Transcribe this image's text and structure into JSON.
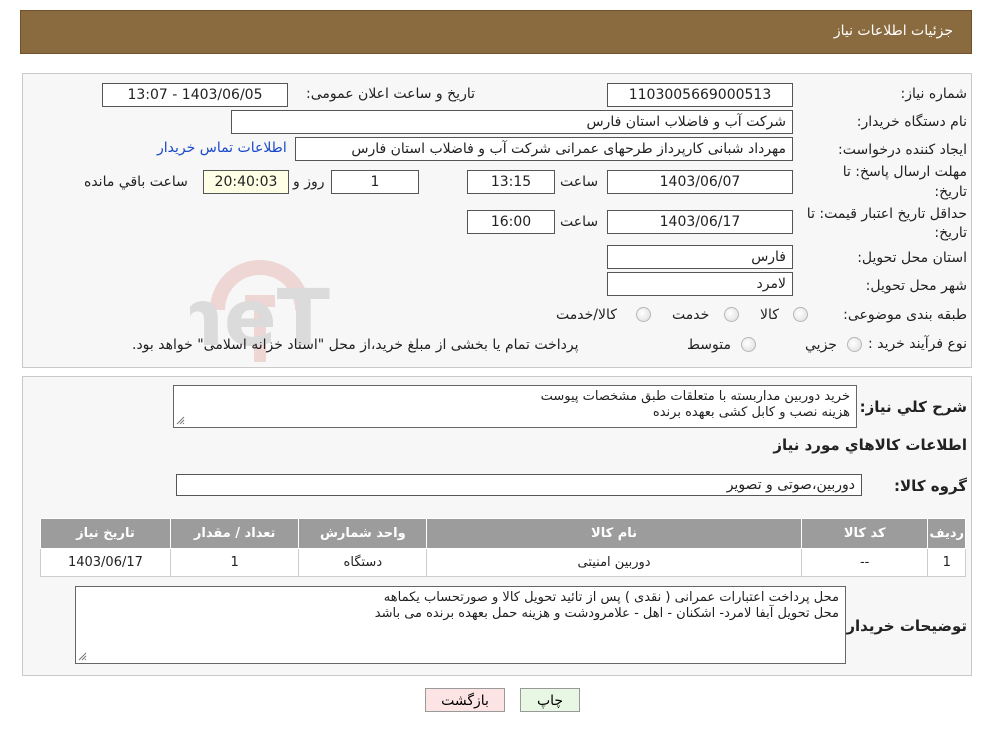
{
  "header": {
    "title": "جزئیات اطلاعات نیاز"
  },
  "form": {
    "need_number_label": "شماره نیاز:",
    "need_number": "1103005669000513",
    "announce_label": "تاریخ و ساعت اعلان عمومی:",
    "announce_value": "1403/06/05 - 13:07",
    "buyer_org_label": "نام دستگاه خریدار:",
    "buyer_org": "شرکت آب و فاضلاب استان فارس",
    "creator_label": "ایجاد کننده درخواست:",
    "creator": "مهرداد شبانی کارپرداز طرحهای عمرانی  شرکت آب و فاضلاب استان فارس",
    "contact_link": "اطلاعات تماس خریدار",
    "deadline_label_1": "مهلت ارسال پاسخ: تا",
    "deadline_label_2": "تاریخ:",
    "deadline_date": "1403/06/07",
    "time_label": "ساعت",
    "deadline_time": "13:15",
    "days_value": "1",
    "days_label": "روز و",
    "remaining_value": "20:40:03",
    "remaining_label": "ساعت باقي مانده",
    "validity_label_1": "حداقل تاریخ اعتبار قیمت: تا",
    "validity_label_2": "تاریخ:",
    "validity_date": "1403/06/17",
    "validity_time": "16:00",
    "province_label": "استان محل تحویل:",
    "province": "فارس",
    "city_label": "شهر محل تحویل:",
    "city": "لامرد",
    "category_label": "طبقه بندی موضوعی:",
    "category_options": [
      "کالا",
      "خدمت",
      "کالا/خدمت"
    ],
    "process_label": "نوع فرآیند خرید :",
    "process_options": [
      "جزيي",
      "متوسط"
    ],
    "process_note": "پرداخت تمام یا بخشی از مبلغ خرید،از محل \"اسناد خزانه اسلامی\" خواهد بود."
  },
  "description": {
    "label": "شرح کلي نياز:",
    "lines": [
      "خرید دوربین مداربسته با متعلقات طبق مشخصات پیوست",
      "هزینه نصب و کابل کشی بعهده برنده"
    ]
  },
  "goods": {
    "section_title": "اطلاعات کالاهاي مورد نياز",
    "group_label": "گروه کالا:",
    "group_value": "دوربین،صوتی و تصویر",
    "columns": [
      "رديف",
      "کد کالا",
      "نام کالا",
      "واحد شمارش",
      "تعداد / مقدار",
      "تاریخ نیاز"
    ],
    "rows": [
      {
        "index": "1",
        "code": "--",
        "name": "دوربین امنیتی",
        "unit": "دستگاه",
        "qty": "1",
        "date": "1403/06/17"
      }
    ]
  },
  "buyer_notes": {
    "label": "توضیحات خریدار:",
    "lines": [
      "محل پرداخت اعتبارات عمرانی ( نقدی ) پس از تائید تحویل کالا و صورتحساب یکماهه",
      "محل تحویل آبفا لامرد- اشکنان - اهل - علامرودشت و هزینه حمل بعهده برنده می باشد"
    ]
  },
  "buttons": {
    "print": "چاپ",
    "back": "بازگشت"
  },
  "watermark": {
    "text": "AriaTender.neT"
  },
  "colors": {
    "header_bg": "#8a6a3f",
    "table_header_bg": "#9c9c9c",
    "back_button_bg": "#fde4e4",
    "print_button_bg": "#e8f7e4",
    "link": "#1a49c8"
  }
}
